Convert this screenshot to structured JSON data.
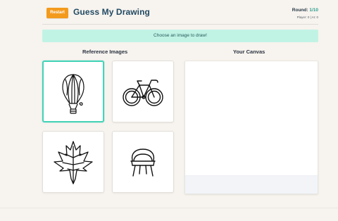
{
  "header": {
    "restart_label": "Restart",
    "title": "Guess My Drawing",
    "round_label": "Round:",
    "round_value": "1/10",
    "score_text": "Player: 0 | AI: 0"
  },
  "status": {
    "message": "Choose an image to draw!"
  },
  "reference": {
    "title": "Reference Images",
    "images": [
      {
        "icon": "hot-air-balloon-icon",
        "selected": true
      },
      {
        "icon": "bicycle-icon",
        "selected": false
      },
      {
        "icon": "maple-leaf-icon",
        "selected": false
      },
      {
        "icon": "chair-icon",
        "selected": false
      }
    ]
  },
  "canvas": {
    "title": "Your Canvas"
  },
  "colors": {
    "accent": "#45d3b8",
    "restart": "#f39a1d",
    "banner": "#c1f3e5",
    "background": "#f7f3ee"
  }
}
